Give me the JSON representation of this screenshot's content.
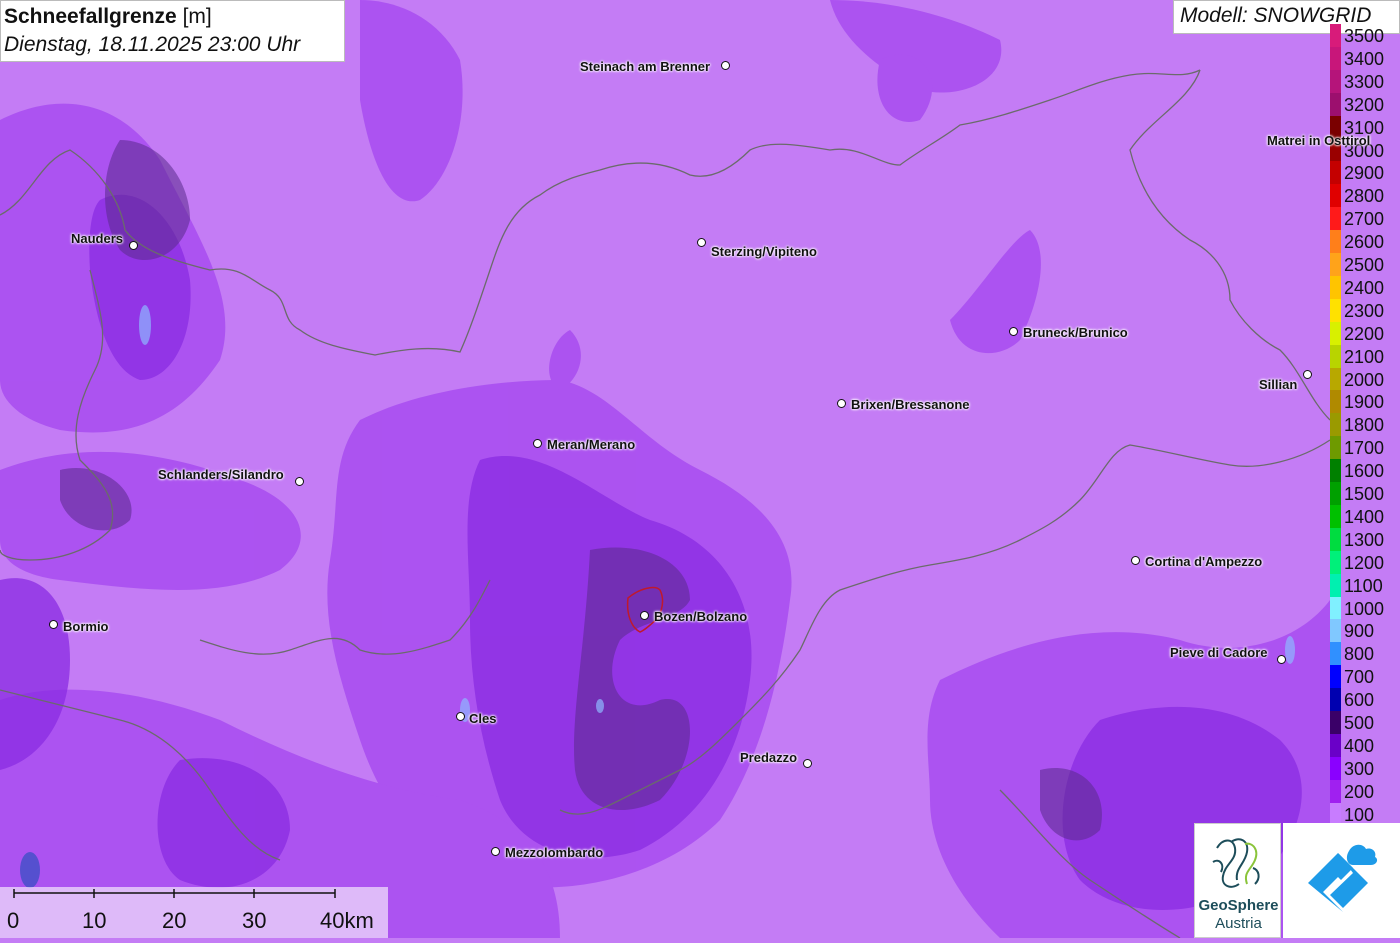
{
  "header": {
    "title_bold": "Schneefallgrenze",
    "title_unit": "[m]",
    "datetime": "Dienstag, 18.11.2025 23:00 Uhr"
  },
  "model": {
    "label": "Modell: SNOWGRID"
  },
  "legend": {
    "items": [
      {
        "label": "3500",
        "color": "#d81b7a"
      },
      {
        "label": "3400",
        "color": "#c8167a"
      },
      {
        "label": "3300",
        "color": "#b5147a"
      },
      {
        "label": "3200",
        "color": "#9c0f6e"
      },
      {
        "label": "3100",
        "color": "#7a0000"
      },
      {
        "label": "3000",
        "color": "#9a0000"
      },
      {
        "label": "2900",
        "color": "#c40000"
      },
      {
        "label": "2800",
        "color": "#e00000"
      },
      {
        "label": "2700",
        "color": "#ff1a1a"
      },
      {
        "label": "2600",
        "color": "#ff7f1a"
      },
      {
        "label": "2500",
        "color": "#ffa31a"
      },
      {
        "label": "2400",
        "color": "#ffc400"
      },
      {
        "label": "2300",
        "color": "#ffe100"
      },
      {
        "label": "2200",
        "color": "#d8f000"
      },
      {
        "label": "2100",
        "color": "#b8d400"
      },
      {
        "label": "2000",
        "color": "#b8a800"
      },
      {
        "label": "1900",
        "color": "#b08a00"
      },
      {
        "label": "1800",
        "color": "#9a9a00"
      },
      {
        "label": "1700",
        "color": "#6e9a00"
      },
      {
        "label": "1600",
        "color": "#008000"
      },
      {
        "label": "1500",
        "color": "#00a000"
      },
      {
        "label": "1400",
        "color": "#00c000"
      },
      {
        "label": "1300",
        "color": "#00dc40"
      },
      {
        "label": "1200",
        "color": "#00f07a"
      },
      {
        "label": "1100",
        "color": "#00f0b0"
      },
      {
        "label": "1000",
        "color": "#80f0ff"
      },
      {
        "label": "900",
        "color": "#80c8ff"
      },
      {
        "label": "800",
        "color": "#3090ff"
      },
      {
        "label": "700",
        "color": "#0000ff"
      },
      {
        "label": "600",
        "color": "#0000b0"
      },
      {
        "label": "500",
        "color": "#3a0068"
      },
      {
        "label": "400",
        "color": "#6a00c8"
      },
      {
        "label": "300",
        "color": "#8a00ff"
      },
      {
        "label": "200",
        "color": "#a020f0"
      },
      {
        "label": "100",
        "color": "#c87cff"
      }
    ]
  },
  "cities": [
    {
      "name": "Steinach am Brenner"
    },
    {
      "name": "Matrei in Osttirol"
    },
    {
      "name": "Nauders"
    },
    {
      "name": "Sterzing/Vipiteno"
    },
    {
      "name": "Bruneck/Brunico"
    },
    {
      "name": "Sillian"
    },
    {
      "name": "Brixen/Bressanone"
    },
    {
      "name": "Meran/Merano"
    },
    {
      "name": "Schlanders/Silandro"
    },
    {
      "name": "Cortina d'Ampezzo"
    },
    {
      "name": "Bozen/Bolzano"
    },
    {
      "name": "Bormio"
    },
    {
      "name": "Pieve di Cadore"
    },
    {
      "name": "Cles"
    },
    {
      "name": "Predazzo"
    },
    {
      "name": "Mezzolombardo"
    }
  ],
  "scale_bar": {
    "labels": [
      "0",
      "10",
      "20",
      "30",
      "40km"
    ]
  },
  "logos": {
    "geosphere_line1": "GeoSphere",
    "geosphere_line2": "Austria"
  },
  "colors": {
    "base": "#c47cf5",
    "mid": "#a84cf0",
    "deep": "#8a2be2",
    "dark": "#5a2a8a",
    "border": "#6b6b6b",
    "city_outline": "#c0192c"
  }
}
